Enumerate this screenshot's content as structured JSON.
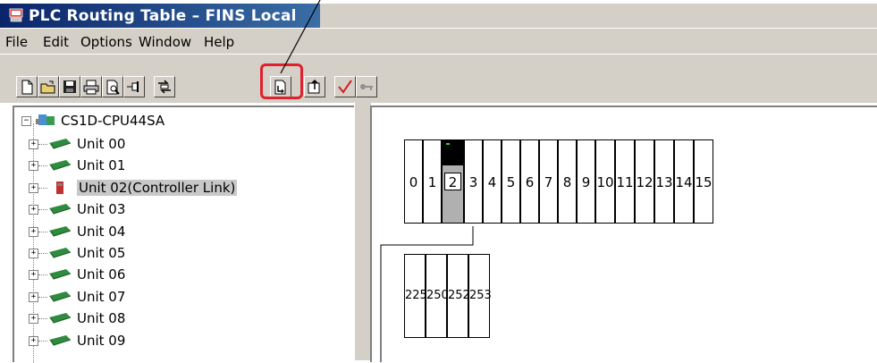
{
  "window": {
    "title": "PLC Routing Table – FINS Local",
    "icon": "plc-app-icon"
  },
  "menu": [
    "File",
    "Edit",
    "Options",
    "Window",
    "Help"
  ],
  "toolbar": {
    "buttons": [
      "new-icon",
      "open-icon",
      "save-icon",
      "print-icon",
      "print-preview-icon",
      "pin-icon",
      "transfer-icon",
      "download-icon",
      "upload-icon",
      "check-icon",
      "key-icon"
    ],
    "highlighted": "download-icon",
    "highlight_color": "#e0202a"
  },
  "tree": {
    "root": "CS1D-CPU44SA",
    "units": [
      {
        "label": "Unit 00",
        "type": "unit"
      },
      {
        "label": "Unit 01",
        "type": "unit"
      },
      {
        "label": "Unit 02(Controller Link)",
        "type": "controller-link",
        "selected": true
      },
      {
        "label": "Unit 03",
        "type": "unit"
      },
      {
        "label": "Unit 04",
        "type": "unit"
      },
      {
        "label": "Unit 05",
        "type": "unit"
      },
      {
        "label": "Unit 06",
        "type": "unit"
      },
      {
        "label": "Unit 07",
        "type": "unit"
      },
      {
        "label": "Unit 08",
        "type": "unit"
      },
      {
        "label": "Unit 09",
        "type": "unit"
      }
    ]
  },
  "rack": {
    "slots": [
      "0",
      "1",
      "2",
      "3",
      "4",
      "5",
      "6",
      "7",
      "8",
      "9",
      "10",
      "11",
      "12",
      "13",
      "14",
      "15"
    ],
    "selected_slot": "2"
  },
  "network": {
    "nodes": [
      "225",
      "250",
      "252",
      "253"
    ]
  }
}
